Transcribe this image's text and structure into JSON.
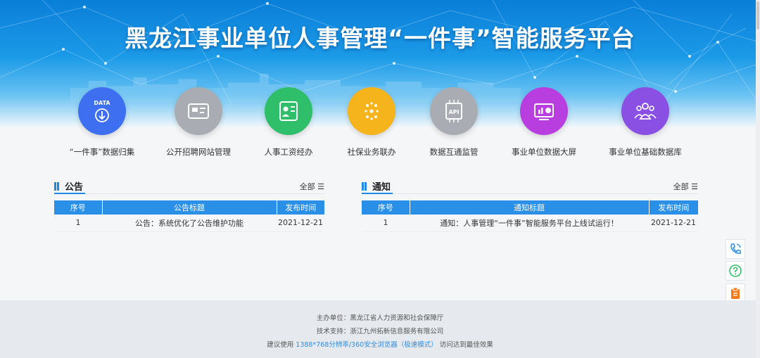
{
  "header": {
    "title": "黑龙江事业单位人事管理“一件事”智能服务平台"
  },
  "apps": [
    {
      "label": "“一件事”数据归集",
      "icon": "data-upload-icon",
      "color": "#3d6ff0",
      "icon_text": "DATA"
    },
    {
      "label": "公开招聘网站管理",
      "icon": "id-card-icon",
      "color": "#a9adb3"
    },
    {
      "label": "人事工资经办",
      "icon": "staff-card-icon",
      "color": "#2fbf6a"
    },
    {
      "label": "社保业务联办",
      "icon": "spark-icon",
      "color": "#f5b31c"
    },
    {
      "label": "数据互通监管",
      "icon": "api-chip-icon",
      "color": "#a9adb3",
      "icon_text": "API"
    },
    {
      "label": "事业单位数据大屏",
      "icon": "dashboard-icon",
      "color": "#b93ee0"
    },
    {
      "label": "事业单位基础数据库",
      "icon": "people-group-icon",
      "color": "#8a4fe3"
    }
  ],
  "announcements": {
    "title": "公告",
    "more": "全部 ☰",
    "columns": [
      "序号",
      "公告标题",
      "发布时间"
    ],
    "rows": [
      {
        "no": "1",
        "title": "公告：系统优化了公告维护功能",
        "date": "2021-12-21"
      }
    ]
  },
  "notices": {
    "title": "通知",
    "more": "全部 ☰",
    "columns": [
      "序号",
      "通知标题",
      "发布时间"
    ],
    "rows": [
      {
        "no": "1",
        "title": "通知：人事管理“一件事”智能服务平台上线试运行！",
        "date": "2021-12-21"
      }
    ]
  },
  "side_tools": [
    {
      "icon": "phone-icon",
      "color": "#2e8fe0"
    },
    {
      "icon": "question-icon",
      "color": "#2fbf6a"
    },
    {
      "icon": "clipboard-icon",
      "color": "#f07a1c"
    }
  ],
  "footer": {
    "host": "主办单位：黑龙江省人力资源和社会保障厅",
    "support": "技术支持：浙江九州拓新信息服务有限公司",
    "hint_prefix": "建议使用",
    "hint_highlight": "1388*768分辨率/360安全浏览器（极速模式）",
    "hint_suffix": "访问达到最佳效果"
  }
}
